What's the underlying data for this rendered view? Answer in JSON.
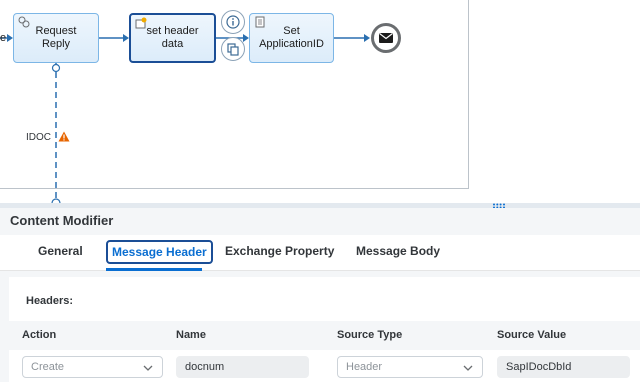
{
  "diagram": {
    "left_edge_label": "e",
    "steps": {
      "request_reply": "Request Reply",
      "set_header_data": "set header data",
      "set_application_id": "Set\nApplicationID"
    },
    "connection_label": "IDOC",
    "colors": {
      "step_border": "#7cb6e6",
      "step_fill": "#dcecfa",
      "selected_border": "#1b4e96",
      "warning": "#e76500"
    }
  },
  "panel": {
    "title": "Content Modifier",
    "tabs": [
      {
        "label": "General"
      },
      {
        "label": "Message Header",
        "selected": true
      },
      {
        "label": "Exchange Property"
      },
      {
        "label": "Message Body"
      }
    ],
    "headers_title": "Headers:",
    "table": {
      "columns": [
        "Action",
        "Name",
        "Source Type",
        "Source Value"
      ],
      "rows": [
        {
          "action": "Create",
          "name": "docnum",
          "source_type": "Header",
          "source_value": "SapIDocDbId"
        }
      ]
    },
    "colors": {
      "accent": "#0a6ed1"
    }
  }
}
